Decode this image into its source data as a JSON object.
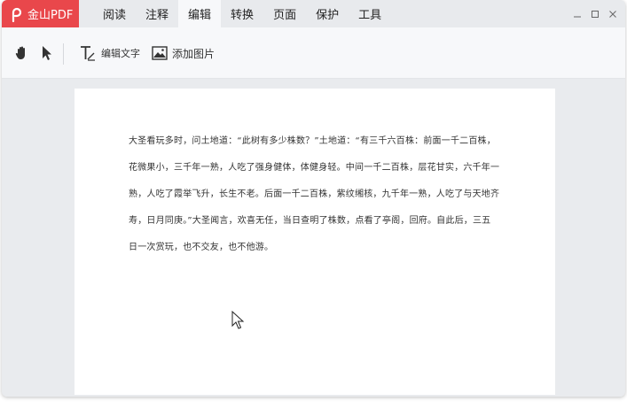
{
  "app": {
    "name": "金山PDF"
  },
  "menu": {
    "items": [
      {
        "label": "阅读"
      },
      {
        "label": "注释"
      },
      {
        "label": "编辑"
      },
      {
        "label": "转换"
      },
      {
        "label": "页面"
      },
      {
        "label": "保护"
      },
      {
        "label": "工具"
      }
    ],
    "active_index": 2
  },
  "toolbar": {
    "hand_tool": "hand-icon",
    "select_tool": "pointer-icon",
    "edit_text_label": "编辑文字",
    "add_image_label": "添加图片"
  },
  "document": {
    "lines": [
      "大圣看玩多时，问土地道：“此树有多少株数？”土地道：“有三千六百株：前面一千二百株，",
      "花微果小，三千年一熟，人吃了强身健体，体健身轻。中间一千二百株，层花甘实，六千年一",
      "熟，人吃了霞举飞升，长生不老。后面一千二百株，紫纹缃核，九千年一熟，人吃了与天地齐",
      "寿，日月同庚。”大圣闻言，欢喜无任，当日查明了株数，点看了亭阁，回府。自此后，三五",
      "日一次赏玩，也不交友，也不他游。"
    ]
  },
  "colors": {
    "brand": "#e9474b",
    "menu_bg": "#e8eaed",
    "toolbar_bg": "#f7f8fa",
    "canvas_bg": "#e9ebee"
  }
}
